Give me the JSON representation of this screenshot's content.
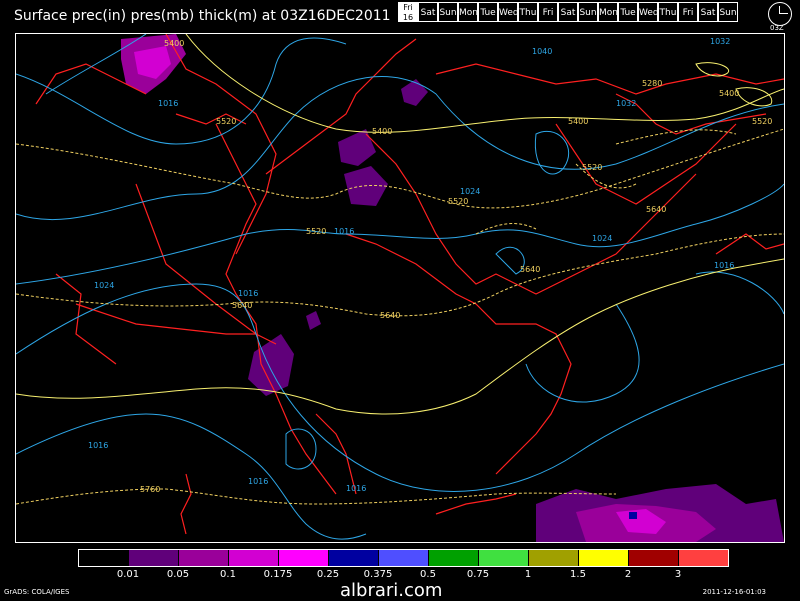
{
  "title": "Surface prec(in) pres(mb) thick(m) at 03Z16DEC2011",
  "day_bar": {
    "active": {
      "top": "Fri",
      "bottom": "16"
    },
    "days": [
      "Sat",
      "Sun",
      "Mon",
      "Tue",
      "Wed",
      "Thu",
      "Fri",
      "Sat",
      "Sun",
      "Mon",
      "Tue",
      "Wed",
      "Thu",
      "Fri",
      "Sat",
      "Sun"
    ],
    "clock_label": "03Z"
  },
  "map": {
    "colors": {
      "coast": "#ff2020",
      "isobar": "#2ea6e6",
      "thickness_cold": "#f0d060",
      "thickness_warm": "#f8f070"
    },
    "isobar_labels": [
      "1040",
      "1032",
      "1032",
      "1024",
      "1024",
      "1024",
      "1016",
      "1016",
      "1016",
      "1016",
      "1016",
      "1016",
      "1016"
    ],
    "thickness_labels": [
      "5400",
      "5400",
      "5400",
      "5400",
      "5280",
      "5520",
      "5520",
      "5520",
      "5520",
      "5520",
      "5640",
      "5640",
      "5640",
      "5640",
      "5760"
    ]
  },
  "legend": {
    "colors": [
      "#000000",
      "#60007a",
      "#9a009a",
      "#d200d2",
      "#ff00ff",
      "#0000a0",
      "#4f4fff",
      "#00a000",
      "#40e040",
      "#a0a000",
      "#ffff00",
      "#a00000",
      "#ff4040"
    ],
    "ticks": [
      "0.01",
      "0.05",
      "0.1",
      "0.175",
      "0.25",
      "0.375",
      "0.5",
      "0.75",
      "1",
      "1.5",
      "2",
      "3"
    ]
  },
  "credit": "GrADS: COLA/IGES",
  "timestamp": "2011-12-16-01:03",
  "watermark": "albrari.com"
}
